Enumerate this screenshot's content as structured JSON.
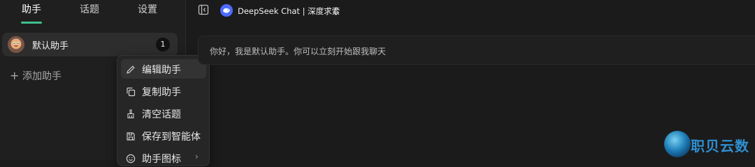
{
  "sidebar": {
    "tabs": [
      {
        "label": "助手"
      },
      {
        "label": "话题"
      },
      {
        "label": "设置"
      }
    ],
    "assistant": {
      "name": "默认助手",
      "count": "1"
    },
    "add_label": "添加助手"
  },
  "context_menu": {
    "items": [
      {
        "label": "编辑助手",
        "icon": "pencil-icon"
      },
      {
        "label": "复制助手",
        "icon": "copy-icon"
      },
      {
        "label": "清空话题",
        "icon": "broom-icon"
      },
      {
        "label": "保存到智能体",
        "icon": "save-icon"
      },
      {
        "label": "助手图标",
        "icon": "smile-icon"
      }
    ]
  },
  "header": {
    "model_name": "DeepSeek Chat | 深度求索"
  },
  "chat": {
    "welcome_message": "你好，我是默认助手。你可以立刻开始跟我聊天"
  },
  "watermark": {
    "text": "职贝云数"
  },
  "colors": {
    "accent": "#3fbf8f",
    "model_logo": "#4d6bfe",
    "background": "#1b1b1b"
  }
}
